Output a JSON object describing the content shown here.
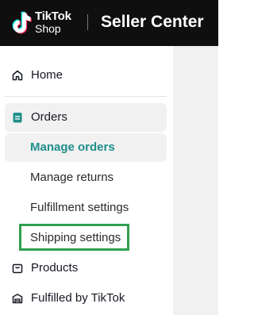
{
  "header": {
    "brand_tiktok": "TikTok",
    "brand_shop": "Shop",
    "title": "Seller Center"
  },
  "sidebar": {
    "home": {
      "label": "Home",
      "icon": "home-icon"
    },
    "orders": {
      "label": "Orders",
      "icon": "orders-icon",
      "active": true,
      "children": [
        {
          "label": "Manage orders",
          "selected": true
        },
        {
          "label": "Manage returns"
        },
        {
          "label": "Fulfillment settings"
        },
        {
          "label": "Shipping settings",
          "highlighted": true
        }
      ]
    },
    "products": {
      "label": "Products",
      "icon": "products-icon"
    },
    "fulfilled_by_tiktok": {
      "label": "Fulfilled by TikTok",
      "icon": "warehouse-icon"
    }
  },
  "colors": {
    "topbar": "#0f0f10",
    "accent_teal": "#1f8f8a",
    "highlight_green": "#2ea04f",
    "active_bg": "#f1f1f2"
  }
}
